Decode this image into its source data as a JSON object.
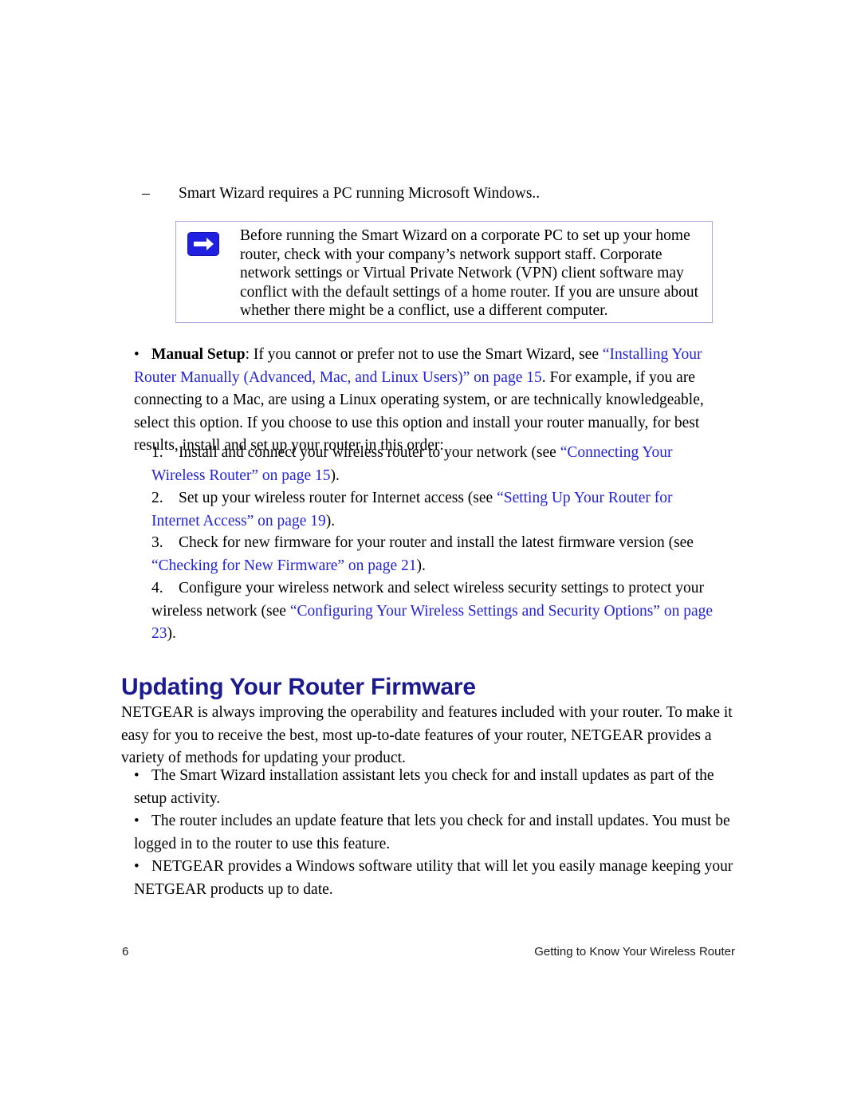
{
  "document": {
    "page_number": "6",
    "footer_title": "Getting to Know Your Wireless Router",
    "colors": {
      "link": "#2323d8",
      "heading": "#1b1b8f",
      "note_border": "#a6a6e2",
      "note_icon_bg": "#2020e0",
      "body_text": "#000000"
    }
  },
  "requirement_note": {
    "marker": "–",
    "text": "Smart Wizard requires a PC running Microsoft Windows.."
  },
  "note_box": {
    "icon": "note-arrow-icon",
    "text": "Before running the Smart Wizard on a corporate PC to set up your home router, check with your company’s network support staff. Corporate network settings or Virtual Private Network (VPN) client software may conflict with the default settings of a home router. If you are unsure about whether there might be a conflict, use a different computer."
  },
  "manual_setup": {
    "marker": "•",
    "lead_bold": "Manual Setup",
    "segment_1": ": If you cannot or prefer not to use the Smart Wizard, see ",
    "link_1": "“Installing Your Router Manually (Advanced, Mac, and Linux Users)” on page 15",
    "segment_2": ". For example, if you are connecting to a Mac, are using a Linux operating system, or are technically knowledgeable, select this option. If you choose to use this option and install your router manually, for best results, install and set up your router in this order:"
  },
  "steps": [
    {
      "marker": "1.",
      "pre": "Install and connect your wireless router to your network (see ",
      "link": "“Connecting Your Wireless Router” on page 15",
      "post": ")."
    },
    {
      "marker": "2.",
      "pre": "Set up your wireless router for Internet access (see ",
      "link": "“Setting Up Your Router for Internet Access” on page 19",
      "post": ")."
    },
    {
      "marker": "3.",
      "pre": "Check for new firmware for your router and install the latest firmware version (see ",
      "link": "“Checking for New Firmware” on page 21",
      "post": ")."
    },
    {
      "marker": "4.",
      "pre": "Configure your wireless network and select wireless security settings to protect your wireless network (see ",
      "link": "“Configuring Your Wireless Settings and Security Options” on page 23",
      "post": ")."
    }
  ],
  "section": {
    "heading": "Updating Your Router Firmware",
    "intro": "NETGEAR is always improving the operability and features included with your router. To make it easy for you to receive the best, most up-to-date features of your router, NETGEAR provides a variety of methods for updating your product.",
    "bullets": [
      {
        "marker": "•",
        "text": "The Smart Wizard installation assistant lets you check for and install updates as part of the setup activity."
      },
      {
        "marker": "•",
        "text": "The router includes an update feature that lets you check for and install updates. You must be logged in to the router to use this feature."
      },
      {
        "marker": "•",
        "text": "NETGEAR provides a Windows software utility that will let you easily manage keeping your NETGEAR products up to date."
      }
    ]
  }
}
